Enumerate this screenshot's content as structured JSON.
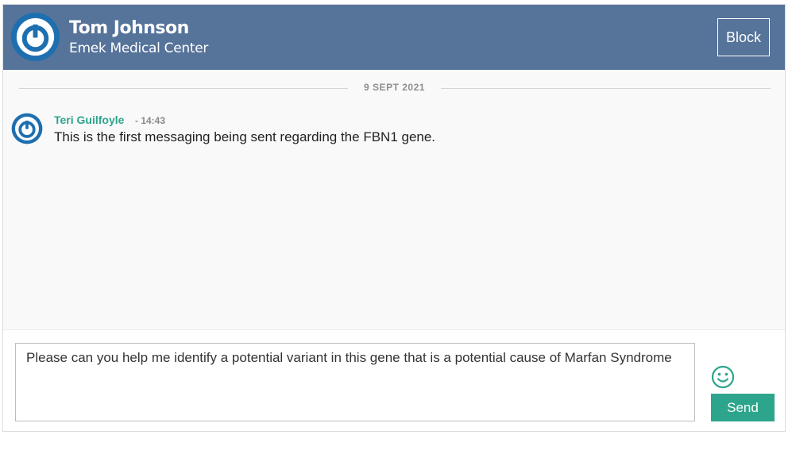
{
  "header": {
    "contact_name": "Tom Johnson",
    "contact_org": "Emek Medical Center",
    "block_label": "Block"
  },
  "conversation": {
    "date_divider": "9 SEPT 2021",
    "messages": [
      {
        "sender": "Teri Guilfoyle",
        "time": "- 14:43",
        "text": "This is the first messaging being sent regarding the FBN1 gene."
      }
    ]
  },
  "composer": {
    "value": "Please can you help me identify a potential variant in this gene that is a potential cause of Marfan Syndrome",
    "send_label": "Send",
    "emoji_icon": "smiley-icon"
  },
  "colors": {
    "header_bg": "#56739a",
    "accent": "#2da58c",
    "avatar_blue": "#1e6fb0"
  }
}
